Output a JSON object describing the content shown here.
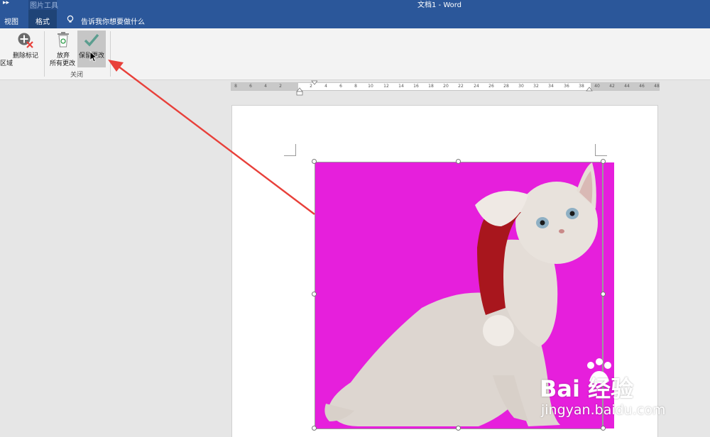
{
  "titlebar": {
    "contextual_tab_group": "图片工具",
    "document_title": "文档1  -  Word",
    "tabs": [
      {
        "label": "视图"
      },
      {
        "label": "格式"
      }
    ],
    "tell_me": "告诉我你想要做什么"
  },
  "ribbon": {
    "partial_label": "区域",
    "delete_mark": "删除标记",
    "discard_line1": "放弃",
    "discard_line2": "所有更改",
    "keep_changes": "保留更改",
    "group_label": "关闭"
  },
  "ruler": {
    "left_ticks": [
      "8",
      "6",
      "4",
      "2"
    ],
    "main_ticks": [
      "2",
      "4",
      "6",
      "8",
      "10",
      "12",
      "14",
      "16",
      "18",
      "20",
      "22",
      "24",
      "26",
      "28",
      "30",
      "32",
      "34",
      "36",
      "38"
    ],
    "right_ticks": [
      "40",
      "42",
      "44",
      "46",
      "48"
    ]
  },
  "watermark": {
    "brand": "Bai  经验",
    "url": "jingyan.baidu.com"
  },
  "colors": {
    "title_bar": "#2b579a",
    "image_background": "#e61fdc",
    "arrow": "#e8403a"
  }
}
